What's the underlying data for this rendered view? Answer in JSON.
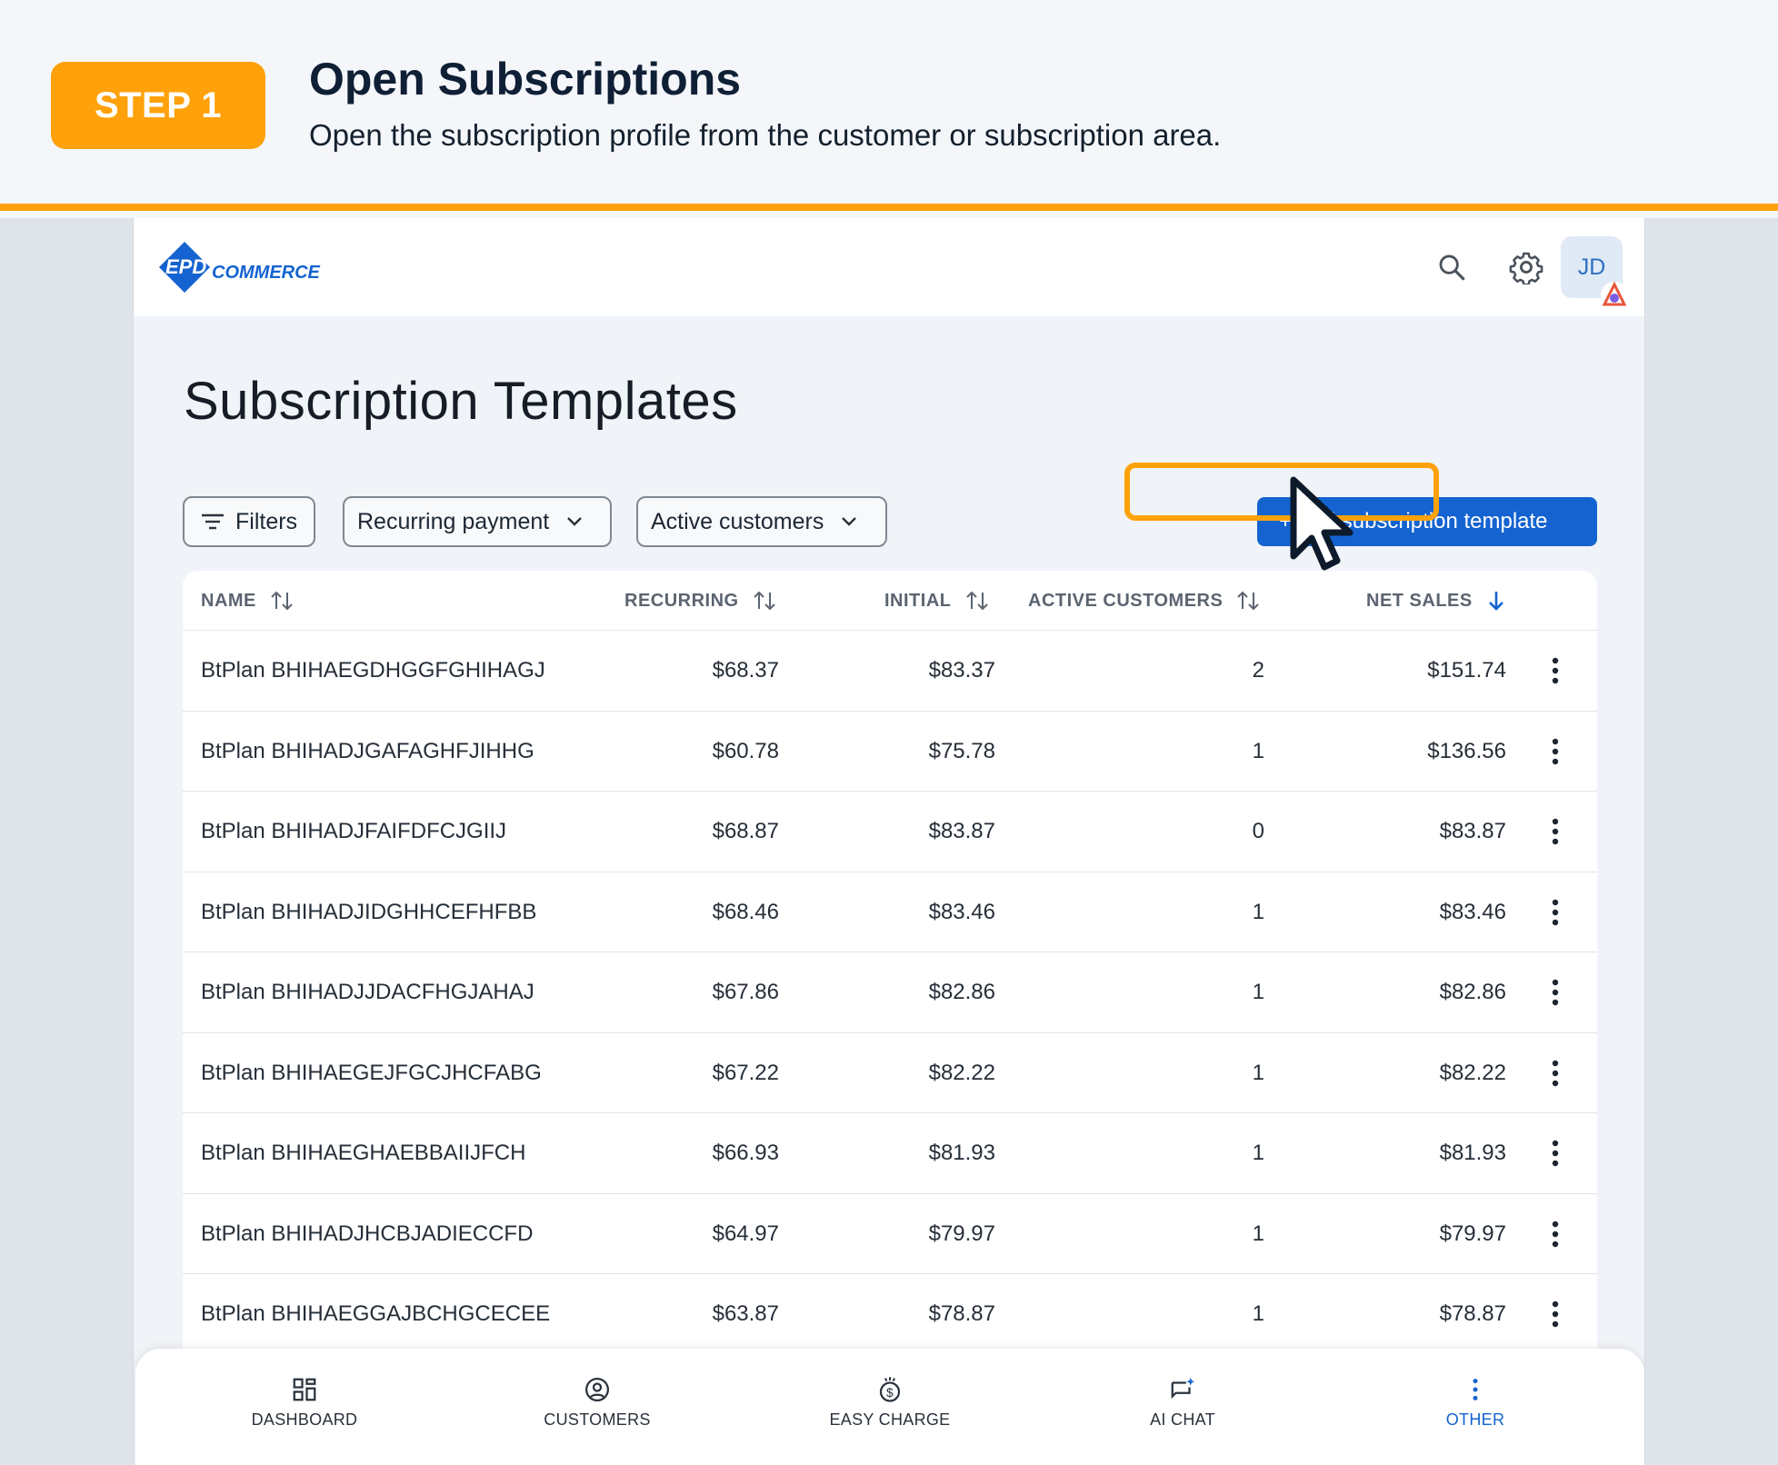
{
  "step": {
    "badge": "STEP 1",
    "title": "Open Subscriptions",
    "description": "Open the subscription profile from the customer or subscription area."
  },
  "app": {
    "logo_text": "EPD COMMERCE",
    "avatar_initials": "JD"
  },
  "page": {
    "title": "Subscription Templates"
  },
  "filters": {
    "filters_label": "Filters",
    "type_select": "Recurring payment",
    "customers_select": "Active customers"
  },
  "add_button_label": "+ Add subscription template",
  "table": {
    "columns": {
      "name": "NAME",
      "recurring": "RECURRING",
      "initial": "INITIAL",
      "active": "ACTIVE CUSTOMERS",
      "net": "NET SALES"
    },
    "rows": [
      {
        "name": "BtPlan BHIHAEGDHGGFGHIHAGJ",
        "recurring": "$68.37",
        "initial": "$83.37",
        "active": "2",
        "net": "$151.74"
      },
      {
        "name": "BtPlan BHIHADJGAFAGHFJIHHG",
        "recurring": "$60.78",
        "initial": "$75.78",
        "active": "1",
        "net": "$136.56"
      },
      {
        "name": "BtPlan BHIHADJFAIFDFCJGIIJ",
        "recurring": "$68.87",
        "initial": "$83.87",
        "active": "0",
        "net": "$83.87"
      },
      {
        "name": "BtPlan BHIHADJIDGHHCEFHFBB",
        "recurring": "$68.46",
        "initial": "$83.46",
        "active": "1",
        "net": "$83.46"
      },
      {
        "name": "BtPlan BHIHADJJDACFHGJAHAJ",
        "recurring": "$67.86",
        "initial": "$82.86",
        "active": "1",
        "net": "$82.86"
      },
      {
        "name": "BtPlan BHIHAEGEJFGCJHCFABG",
        "recurring": "$67.22",
        "initial": "$82.22",
        "active": "1",
        "net": "$82.22"
      },
      {
        "name": "BtPlan BHIHAEGHAEBBAIIJFCH",
        "recurring": "$66.93",
        "initial": "$81.93",
        "active": "1",
        "net": "$81.93"
      },
      {
        "name": "BtPlan BHIHADJHCBJADIECCFD",
        "recurring": "$64.97",
        "initial": "$79.97",
        "active": "1",
        "net": "$79.97"
      },
      {
        "name": "BtPlan BHIHAEGGAJBCHGCECEE",
        "recurring": "$63.87",
        "initial": "$78.87",
        "active": "1",
        "net": "$78.87"
      }
    ]
  },
  "nav": {
    "dashboard": "DASHBOARD",
    "customers": "CUSTOMERS",
    "easy_charge": "EASY CHARGE",
    "ai_chat": "AI CHAT",
    "other": "OTHER"
  },
  "colors": {
    "accent_orange": "#ffa10a",
    "primary_blue": "#1463d0"
  }
}
